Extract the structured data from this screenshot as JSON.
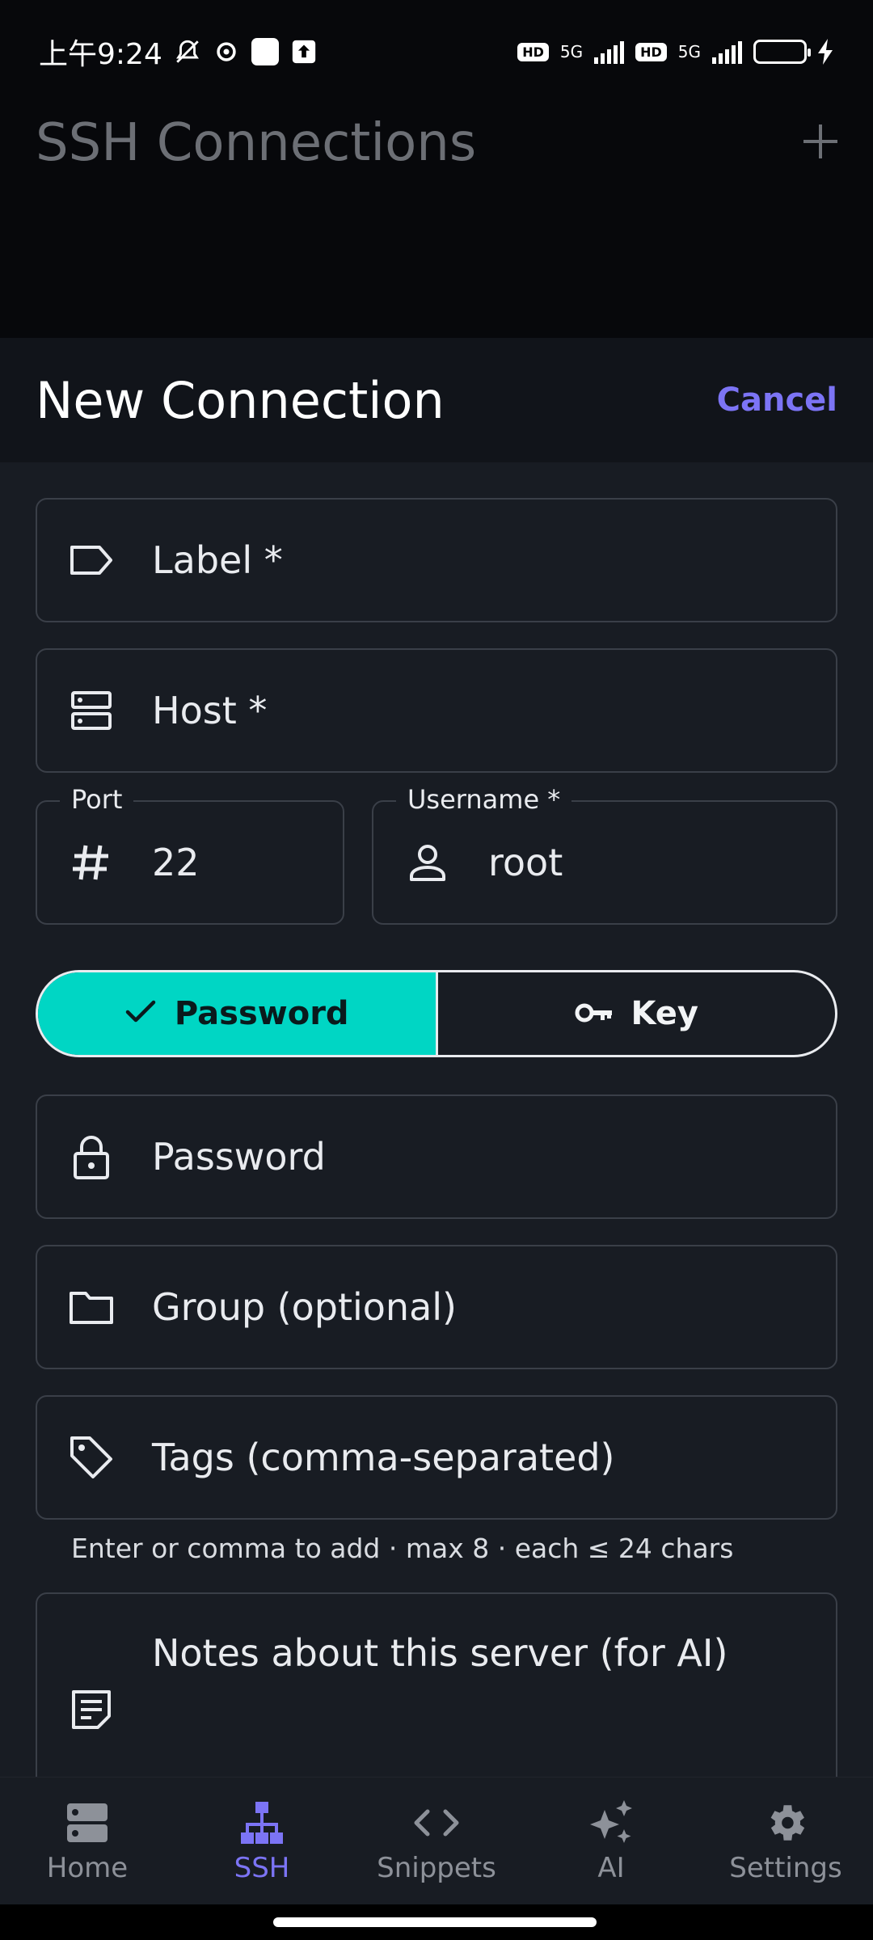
{
  "status_bar": {
    "time": "上午9:24",
    "network_1": "5G",
    "network_2": "5G",
    "hd_1": "HD",
    "hd_2": "HD"
  },
  "background_screen": {
    "title": "SSH Connections"
  },
  "sheet": {
    "title": "New Connection",
    "cancel_label": "Cancel"
  },
  "form": {
    "label_placeholder": "Label *",
    "host_placeholder": "Host *",
    "port_label": "Port",
    "port_value": "22",
    "username_label": "Username *",
    "username_value": "root",
    "auth_password_label": "Password",
    "auth_key_label": "Key",
    "password_placeholder": "Password",
    "group_placeholder": "Group (optional)",
    "tags_placeholder": "Tags (comma-separated)",
    "tags_hint": "Enter or comma to add · max 8 · each ≤ 24 chars",
    "notes_placeholder": "Notes about this server (for AI)"
  },
  "bottom_nav": {
    "items": [
      {
        "label": "Home",
        "icon": "server-icon"
      },
      {
        "label": "SSH",
        "icon": "network-icon"
      },
      {
        "label": "Snippets",
        "icon": "code-icon"
      },
      {
        "label": "AI",
        "icon": "sparkles-icon"
      },
      {
        "label": "Settings",
        "icon": "gear-icon"
      }
    ],
    "active": "SSH"
  },
  "colors": {
    "accent_purple": "#7c74f5",
    "accent_teal": "#00d6c4",
    "sheet_bg": "#181c23"
  }
}
